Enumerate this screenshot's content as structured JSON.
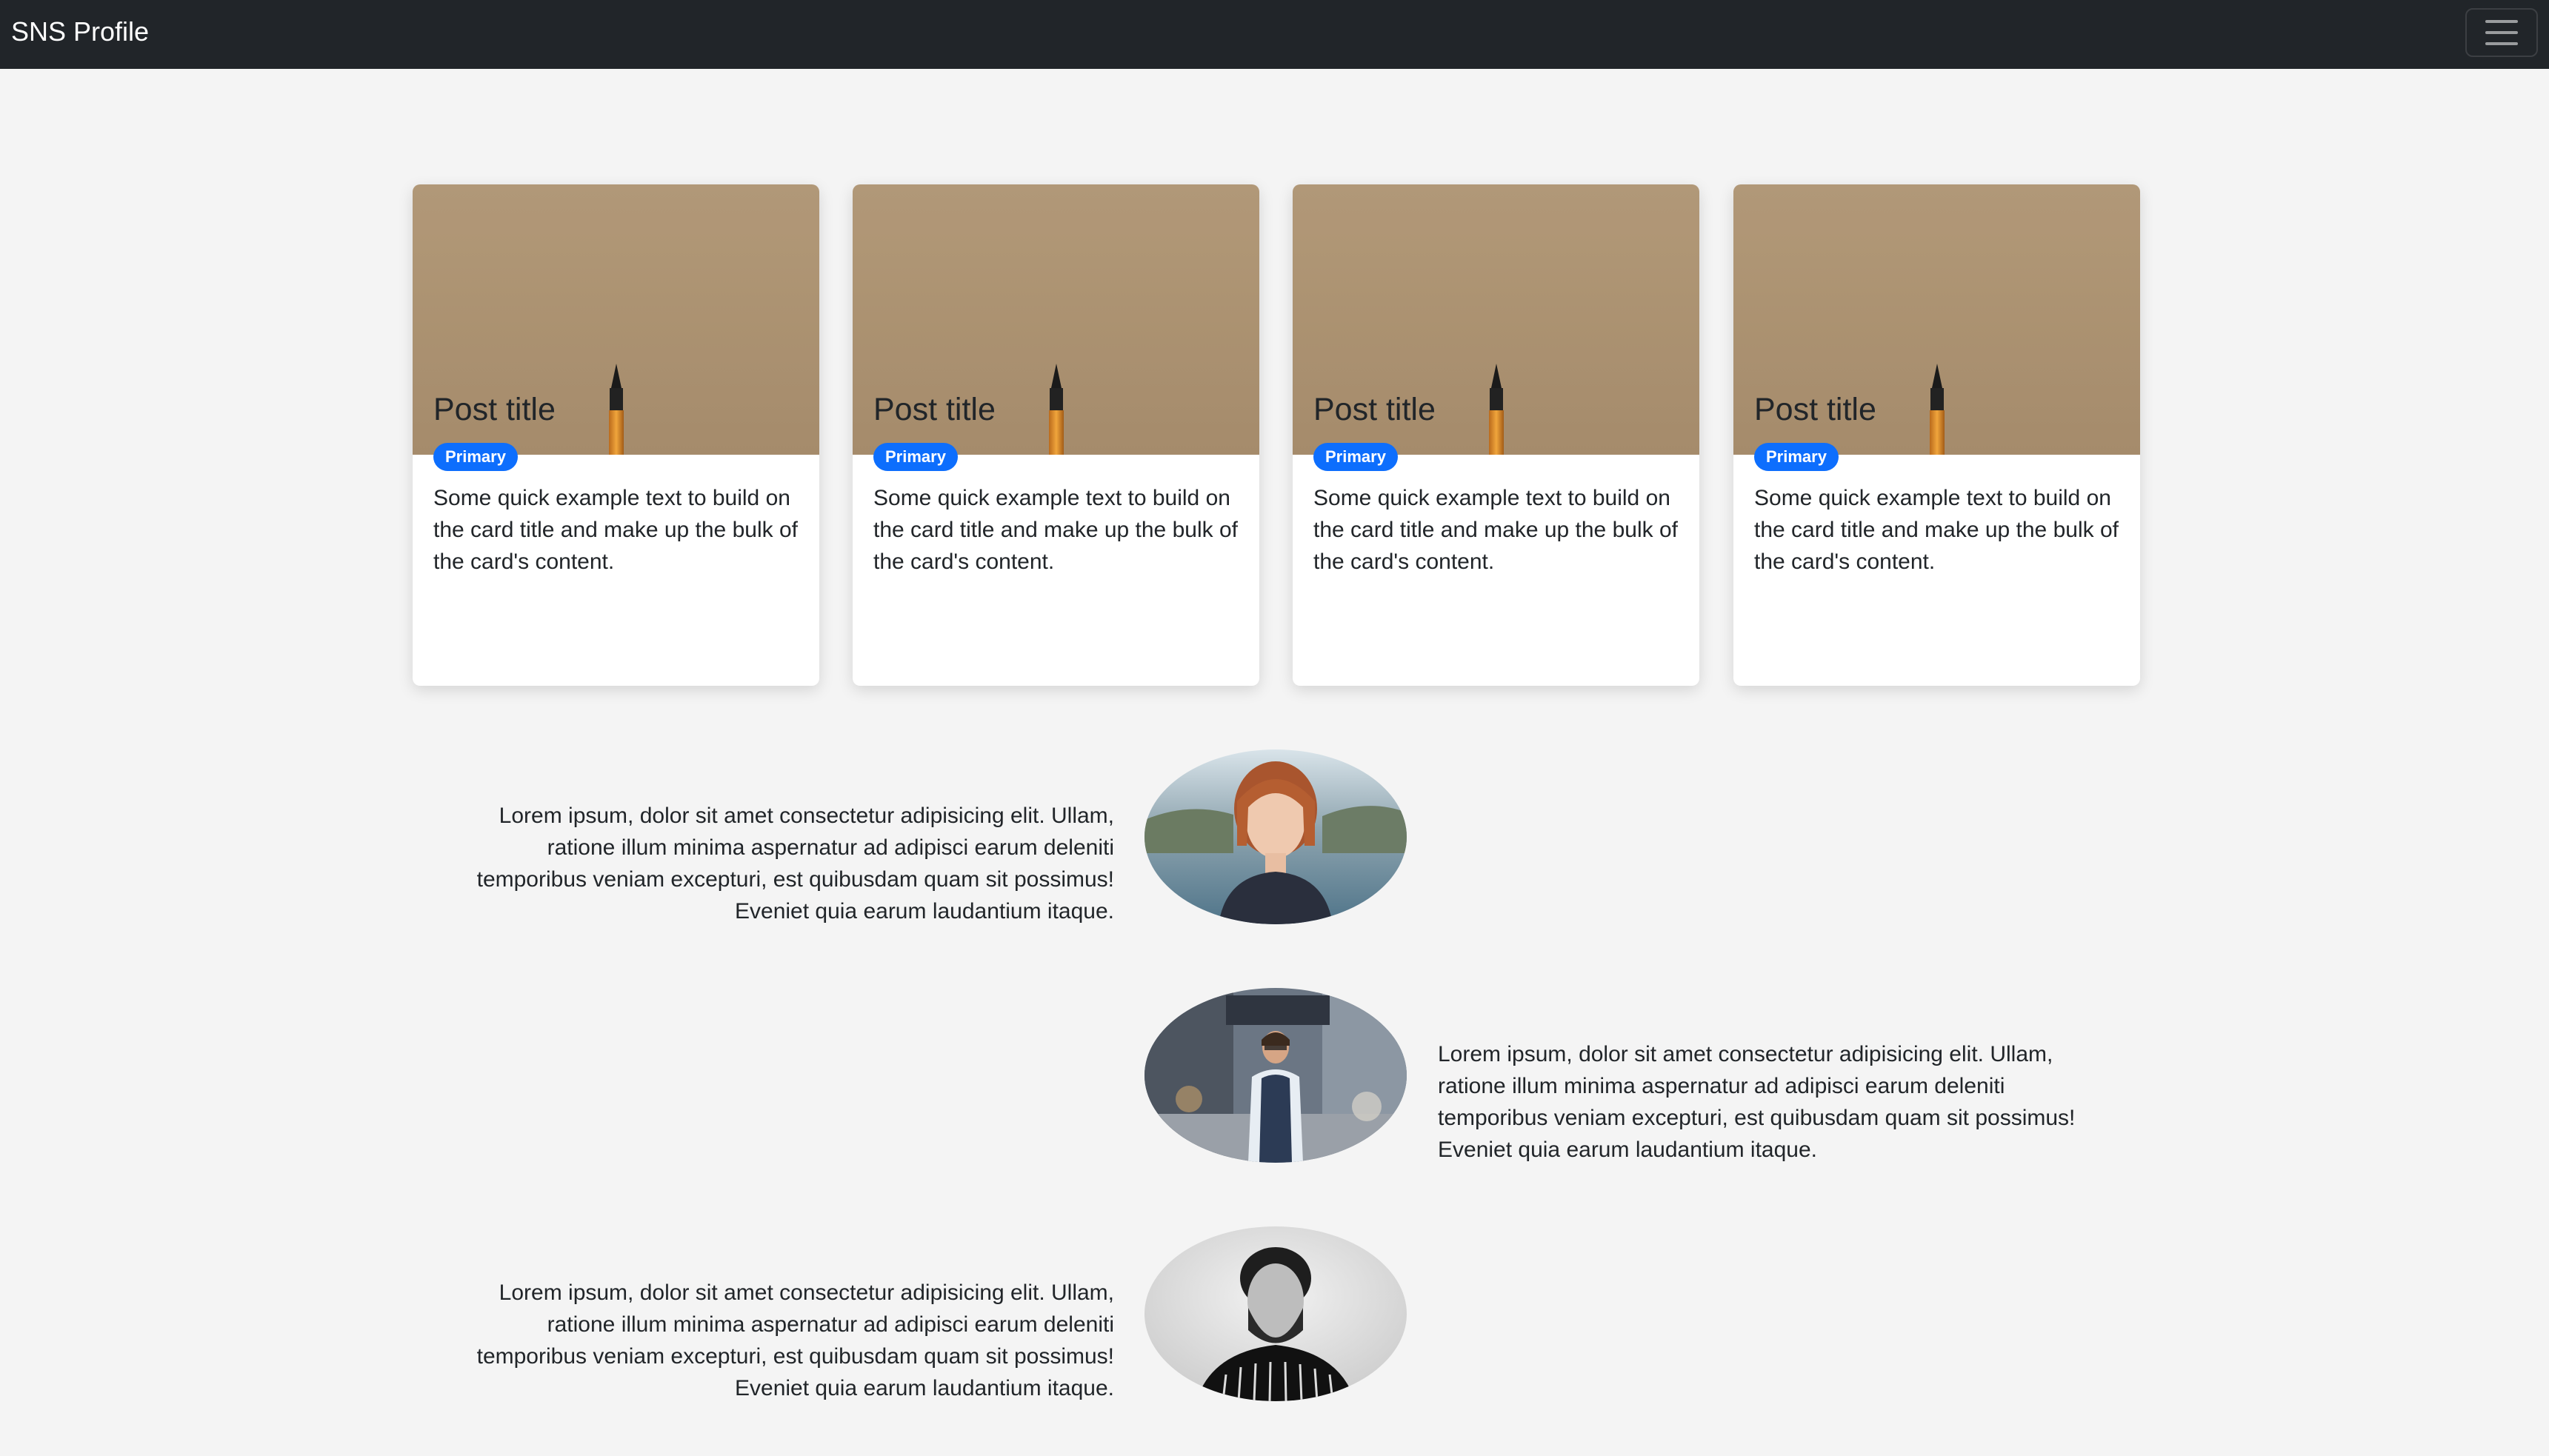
{
  "navbar": {
    "brand": "SNS Profile",
    "toggler_icon": "hamburger-menu-icon"
  },
  "cards": [
    {
      "title": "Post title",
      "badge": "Primary",
      "text": "Some quick example text to build on the card title and make up the bulk of the card's content.",
      "image_icon": "pen-on-paper-image"
    },
    {
      "title": "Post title",
      "badge": "Primary",
      "text": "Some quick example text to build on the card title and make up the bulk of the card's content.",
      "image_icon": "pen-on-paper-image"
    },
    {
      "title": "Post title",
      "badge": "Primary",
      "text": "Some quick example text to build on the card title and make up the bulk of the card's content.",
      "image_icon": "pen-on-paper-image"
    },
    {
      "title": "Post title",
      "badge": "Primary",
      "text": "Some quick example text to build on the card title and make up the bulk of the card's content.",
      "image_icon": "pen-on-paper-image"
    }
  ],
  "features": [
    {
      "text": "Lorem ipsum, dolor sit amet consectetur adipisicing elit. Ullam, ratione illum minima aspernatur ad adipisci earum deleniti temporibus veniam excepturi, est quibusdam quam sit possimus! Eveniet quia earum laudantium itaque.",
      "align": "right",
      "avatar_icon": "woman-portrait-avatar"
    },
    {
      "text": "Lorem ipsum, dolor sit amet consectetur adipisicing elit. Ullam, ratione illum minima aspernatur ad adipisci earum deleniti temporibus veniam excepturi, est quibusdam quam sit possimus! Eveniet quia earum laudantium itaque.",
      "align": "left",
      "avatar_icon": "man-street-portrait-avatar"
    },
    {
      "text": "Lorem ipsum, dolor sit amet consectetur adipisicing elit. Ullam, ratione illum minima aspernatur ad adipisci earum deleniti temporibus veniam excepturi, est quibusdam quam sit possimus! Eveniet quia earum laudantium itaque.",
      "align": "right",
      "avatar_icon": "bearded-man-portrait-avatar"
    }
  ],
  "colors": {
    "navbar_bg": "#212529",
    "page_bg": "#f4f4f4",
    "badge_bg": "#0d6efd",
    "card_bg": "#ffffff"
  }
}
